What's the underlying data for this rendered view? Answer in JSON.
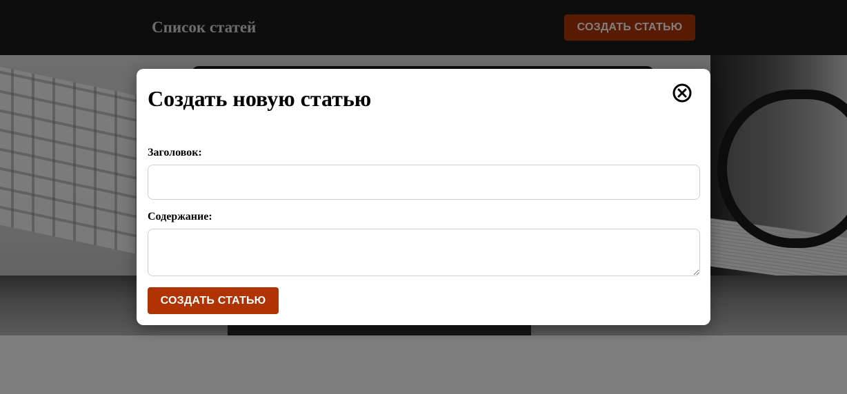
{
  "header": {
    "title": "Список статей",
    "create_button_label": "СОЗДАТЬ СТАТЬЮ"
  },
  "modal": {
    "title": "Создать новую статью",
    "close_icon": "close-circle-icon",
    "fields": {
      "title_label": "Заголовок:",
      "title_value": "",
      "content_label": "Содержание:",
      "content_value": ""
    },
    "submit_label": "СОЗДАТЬ СТАТЬЮ"
  },
  "colors": {
    "accent": "#b03403",
    "header_bg": "#1c1a1a",
    "overlay": "rgba(0,0,0,0.5)"
  }
}
